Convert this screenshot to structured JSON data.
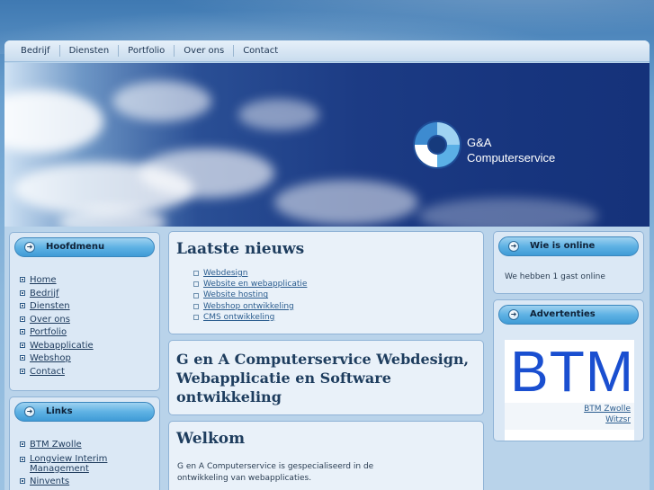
{
  "nav": {
    "items": [
      {
        "label": "Bedrijf"
      },
      {
        "label": "Diensten"
      },
      {
        "label": "Portfolio"
      },
      {
        "label": "Over ons"
      },
      {
        "label": "Contact"
      }
    ]
  },
  "banner": {
    "logo_line1": "G&A",
    "logo_line2": "Computerservice"
  },
  "hoofdmenu": {
    "title": "Hoofdmenu",
    "items": [
      {
        "label": "Home"
      },
      {
        "label": "Bedrijf"
      },
      {
        "label": "Diensten"
      },
      {
        "label": "Over ons"
      },
      {
        "label": "Portfolio"
      },
      {
        "label": "Webapplicatie"
      },
      {
        "label": "Webshop"
      },
      {
        "label": "Contact"
      }
    ]
  },
  "links": {
    "title": "Links",
    "items": [
      {
        "label": "BTM Zwolle"
      },
      {
        "label": "Longview Interim Management"
      },
      {
        "label": "Ninvents"
      }
    ]
  },
  "nieuws": {
    "title": "Laatste nieuws",
    "items": [
      {
        "label": "Webdesign"
      },
      {
        "label": "Website en webapplicatie"
      },
      {
        "label": "Website hosting"
      },
      {
        "label": "Webshop ontwikkeling"
      },
      {
        "label": "CMS ontwikkeling"
      }
    ]
  },
  "intro": {
    "title": "G en A Computerservice Webdesign, Webapplicatie en Software ontwikkeling"
  },
  "welkom": {
    "title": "Welkom",
    "text": "G en A Computerservice is gespecialiseerd in de ontwikkeling van webapplicaties."
  },
  "online": {
    "title": "Wie is online",
    "text": "We hebben 1 gast online"
  },
  "ads": {
    "title": "Advertenties",
    "banner_text": "BTM",
    "link1": "BTM Zwolle",
    "link2": "Witzsr"
  },
  "colors": {
    "pill": "#5fb2e4",
    "heading": "#1e3d5e",
    "btm": "#1a4fd0"
  }
}
